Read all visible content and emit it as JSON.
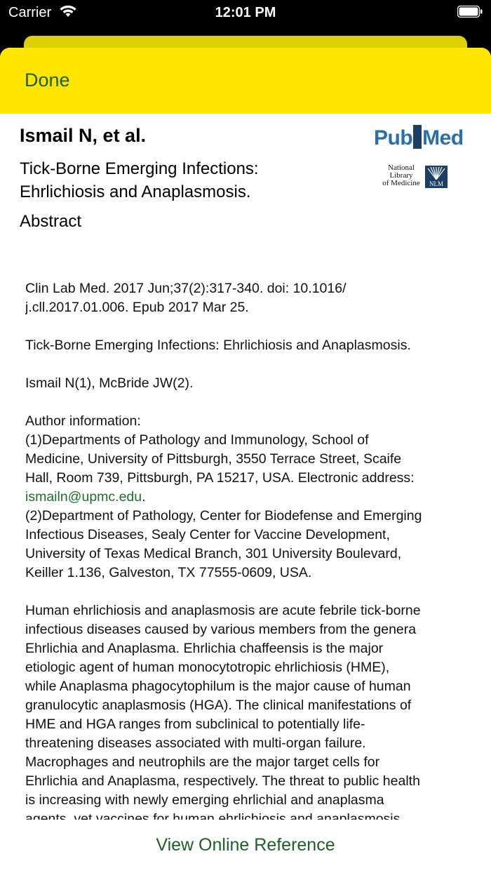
{
  "status_bar": {
    "carrier": "Carrier",
    "time": "12:01 PM"
  },
  "nav": {
    "done_label": "Done"
  },
  "header": {
    "author": "Ismail N, et al.",
    "title_line1": "Tick-Borne Emerging Infections:",
    "title_line2": "Ehrlichiosis and Anaplasmosis.",
    "section": "Abstract"
  },
  "logos": {
    "pubmed_part1": "Pub",
    "pubmed_part2": "Med",
    "nlm_line1": "National",
    "nlm_line2": "Library",
    "nlm_line3": "of Medicine",
    "nlm_tag": "NLM"
  },
  "abstract": {
    "citation": [
      "Clin Lab Med. 2017 Jun;37(2):317-340. doi: 10.1016/",
      "j.cll.2017.01.006. Epub 2017 Mar 25."
    ],
    "title": "Tick-Borne Emerging Infections: Ehrlichiosis and Anaplasmosis.",
    "authors": "Ismail N(1), McBride JW(2).",
    "author_info_heading": "Author information:",
    "affiliation1": [
      "(1)Departments of Pathology and Immunology, School of",
      "Medicine, University of Pittsburgh, 3550 Terrace Street, Scaife",
      "Hall, Room 739, Pittsburgh, PA 15217, USA. Electronic address:"
    ],
    "email": "ismailn@upmc.edu",
    "email_suffix": ".",
    "affiliation2": [
      "(2)Department of Pathology, Center for Biodefense and Emerging",
      "Infectious Diseases, Sealy Center for Vaccine Development,",
      "University of Texas Medical Branch, 301 University Boulevard,",
      "Keiller 1.136, Galveston, TX 77555-0609, USA."
    ],
    "body": [
      "Human ehrlichiosis and anaplasmosis are acute febrile tick-borne",
      "infectious diseases caused by various members from the genera",
      "Ehrlichia and Anaplasma. Ehrlichia chaffeensis is the major",
      "etiologic agent of human monocytotropic ehrlichiosis (HME),",
      "while Anaplasma phagocytophilum is the major cause of human",
      "granulocytic anaplasmosis (HGA). The clinical manifestations of",
      "HME and HGA ranges from subclinical to potentially life-",
      "threatening diseases associated with  multi-organ failure.",
      "Macrophages and neutrophils are the major target cells for",
      "Ehrlichia and Anaplasma, respectively. The threat to public health",
      "is increasing  with newly emerging ehrlichial and anaplasma",
      "agents, yet vaccines for human ehrlichiosis and anaplasmosis"
    ]
  },
  "footer": {
    "view_online_label": "View Online Reference"
  }
}
